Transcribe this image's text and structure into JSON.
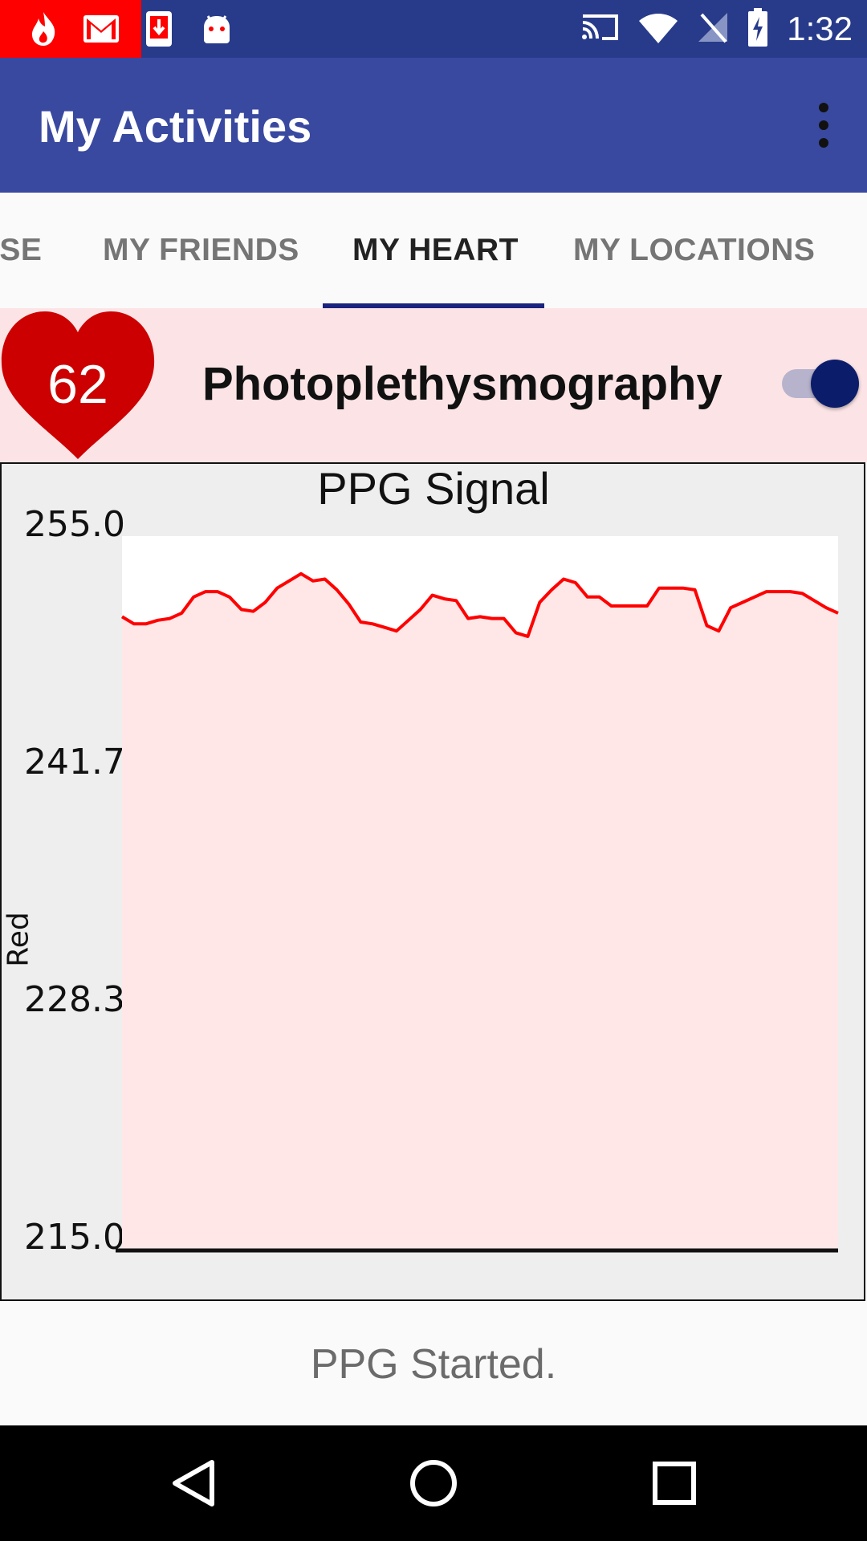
{
  "status_bar": {
    "time": "1:32",
    "left_icons": [
      "flame-icon",
      "gmail-icon",
      "download-icon",
      "android-icon"
    ],
    "right_icons": [
      "cast-icon",
      "wifi-icon",
      "no-signal-icon",
      "battery-charging-icon"
    ]
  },
  "app_bar": {
    "title": "My Activities",
    "overflow_icon": "more-vert-icon"
  },
  "tabs": [
    {
      "label": "ISE",
      "active": false
    },
    {
      "label": "MY FRIENDS",
      "active": false
    },
    {
      "label": "MY HEART",
      "active": true
    },
    {
      "label": "MY LOCATIONS",
      "active": false
    }
  ],
  "heart_card": {
    "heart_rate": "62",
    "title": "Photoplethysmography",
    "toggle_on": true
  },
  "colors": {
    "primary": "#3949a0",
    "primary_dark": "#283b8a",
    "accent": "#0b1c6b",
    "heart": "#cc0000",
    "line": "#ff0000"
  },
  "chart_data": {
    "type": "line",
    "title": "PPG Signal",
    "ylabel": "Red",
    "xlabel": "",
    "ylim": [
      215.0,
      255.0
    ],
    "yticks": [
      "255.0",
      "241.7",
      "228.3",
      "215.0"
    ],
    "series": [
      {
        "values": [
          250.5,
          250.1,
          250.1,
          250.3,
          250.4,
          250.7,
          251.6,
          251.9,
          251.9,
          251.6,
          250.9,
          250.8,
          251.3,
          252.1,
          252.5,
          252.9,
          252.5,
          252.6,
          252.0,
          251.2,
          250.2,
          250.1,
          249.9,
          249.7,
          250.3,
          250.9,
          251.7,
          251.5,
          251.4,
          250.4,
          250.5,
          250.4,
          250.4,
          249.6,
          249.4,
          251.3,
          252.0,
          252.6,
          252.4,
          251.6,
          251.6,
          251.1,
          251.1,
          251.1,
          251.1,
          252.1,
          252.1,
          252.1,
          252.0,
          250.0,
          249.7,
          251.0,
          251.3,
          251.6,
          251.9,
          251.9,
          251.9,
          251.8,
          251.4,
          251.0,
          250.7
        ]
      }
    ]
  },
  "status_message": "PPG Started.",
  "nav_bar": {
    "icons": [
      "back-icon",
      "home-icon",
      "recents-icon"
    ]
  }
}
